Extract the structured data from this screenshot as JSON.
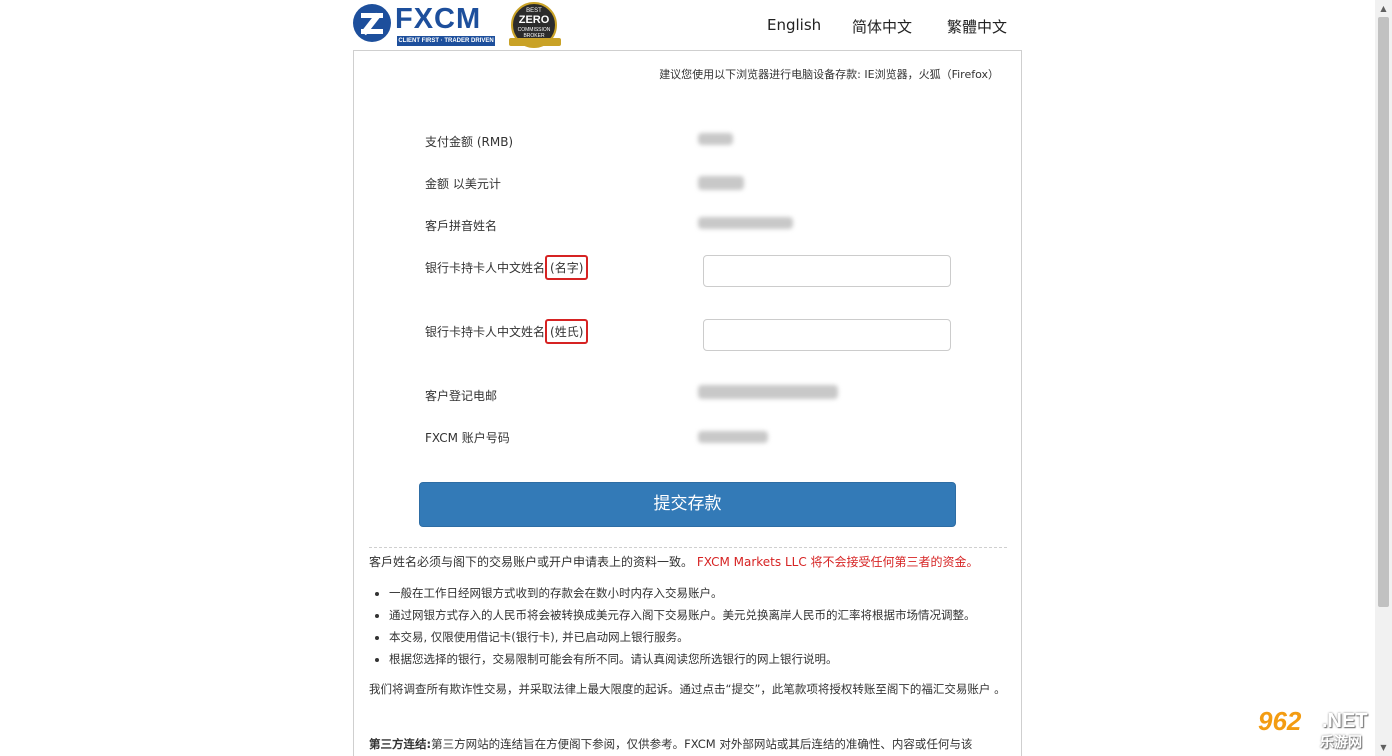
{
  "header": {
    "logo_text": "FXCM",
    "logo_tagline": "CLIENT FIRST · TRADER DRIVEN",
    "badge": {
      "line1": "BEST",
      "line2": "ZERO",
      "line3": "COMMISSION",
      "line4": "BROKER"
    },
    "languages": [
      "English",
      "简体中文",
      "繁體中文"
    ]
  },
  "form": {
    "browser_note": "建议您使用以下浏览器进行电脑设备存款: IE浏览器，火狐（Firefox）",
    "rows": {
      "amount_rmb": "支付金额 (RMB)",
      "amount_usd": "金额 以美元计",
      "pinyin_name": "客戶拼音姓名",
      "card_first_name": "银行卡持卡人中文姓名",
      "card_first_name_tag": "(名字)",
      "card_last_name": "银行卡持卡人中文姓名",
      "card_last_name_tag": "(姓氏)",
      "email": "客户登记电邮",
      "account_no": "FXCM 账户号码"
    },
    "submit_label": "提交存款"
  },
  "notes": {
    "notice_main": "客戶姓名必须与阁下的交易账户或开户申请表上的资料一致。",
    "notice_red": "FXCM Markets LLC 将不会接受任何第三者的资金。",
    "bullets": [
      "一般在工作日经网银方式收到的存款会在数小时内存入交易账户。",
      "通过网银方式存入的人民币将会被转换成美元存入阁下交易账户。美元兑换离岸人民币的汇率将根据市场情况调整。",
      "本交易, 仅限使用借记卡(银行卡), 并已启动网上银行服务。",
      "根据您选择的银行，交易限制可能会有所不同。请认真阅读您所选银行的网上银行说明。"
    ],
    "fraud_para": "我们将调查所有欺诈性交易，并采取法律上最大限度的起诉。通过点击“提交”，此笔款项将授权转账至阁下的福汇交易账户 。",
    "third_party_label": "第三方连结:",
    "third_party_text": "第三方网站的连结旨在方便阁下参阅，仅供参考。FXCM 对外部网站或其后连结的准确性、内容或任何与该"
  },
  "watermark": {
    "num": "962",
    "net": ".NET",
    "sub": "乐游网"
  }
}
